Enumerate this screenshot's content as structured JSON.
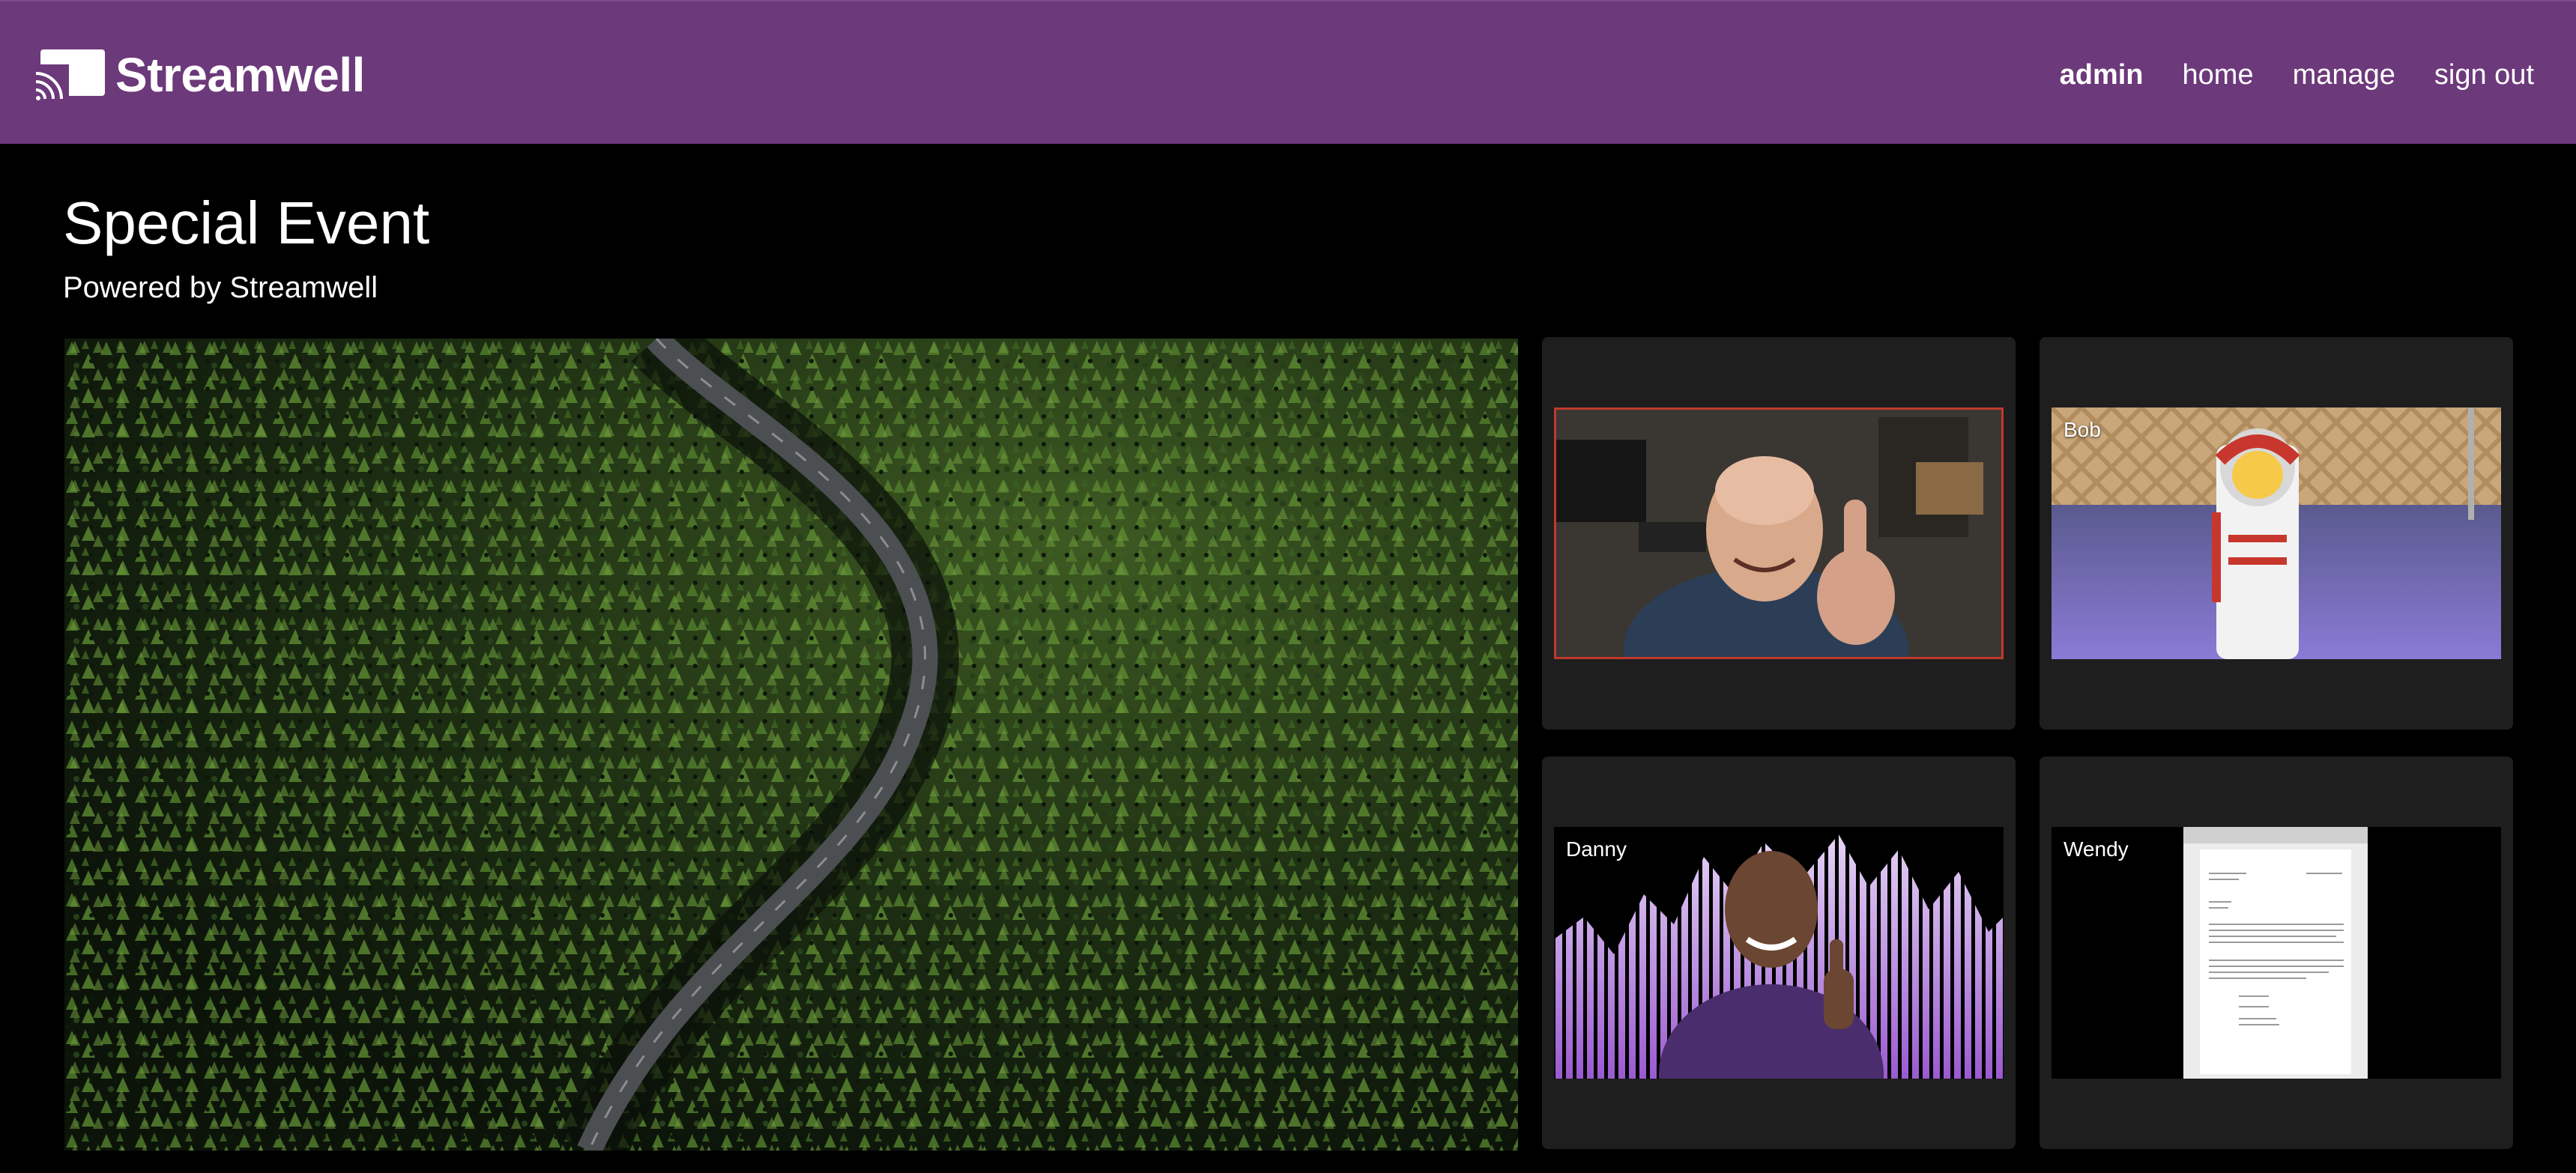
{
  "brand": {
    "name": "Streamwell"
  },
  "nav": {
    "admin": "admin",
    "home": "home",
    "manage": "manage",
    "sign_out": "sign out"
  },
  "event": {
    "title": "Special Event",
    "subtitle": "Powered by Streamwell"
  },
  "participants": [
    {
      "name": "",
      "speaking": true
    },
    {
      "name": "Bob",
      "speaking": false
    },
    {
      "name": "Danny",
      "speaking": false
    },
    {
      "name": "Wendy",
      "speaking": false
    }
  ],
  "colors": {
    "navbar": "#6c397a",
    "background": "#000000",
    "tile": "#1e1e1e",
    "speaking_border": "#c0392b"
  }
}
